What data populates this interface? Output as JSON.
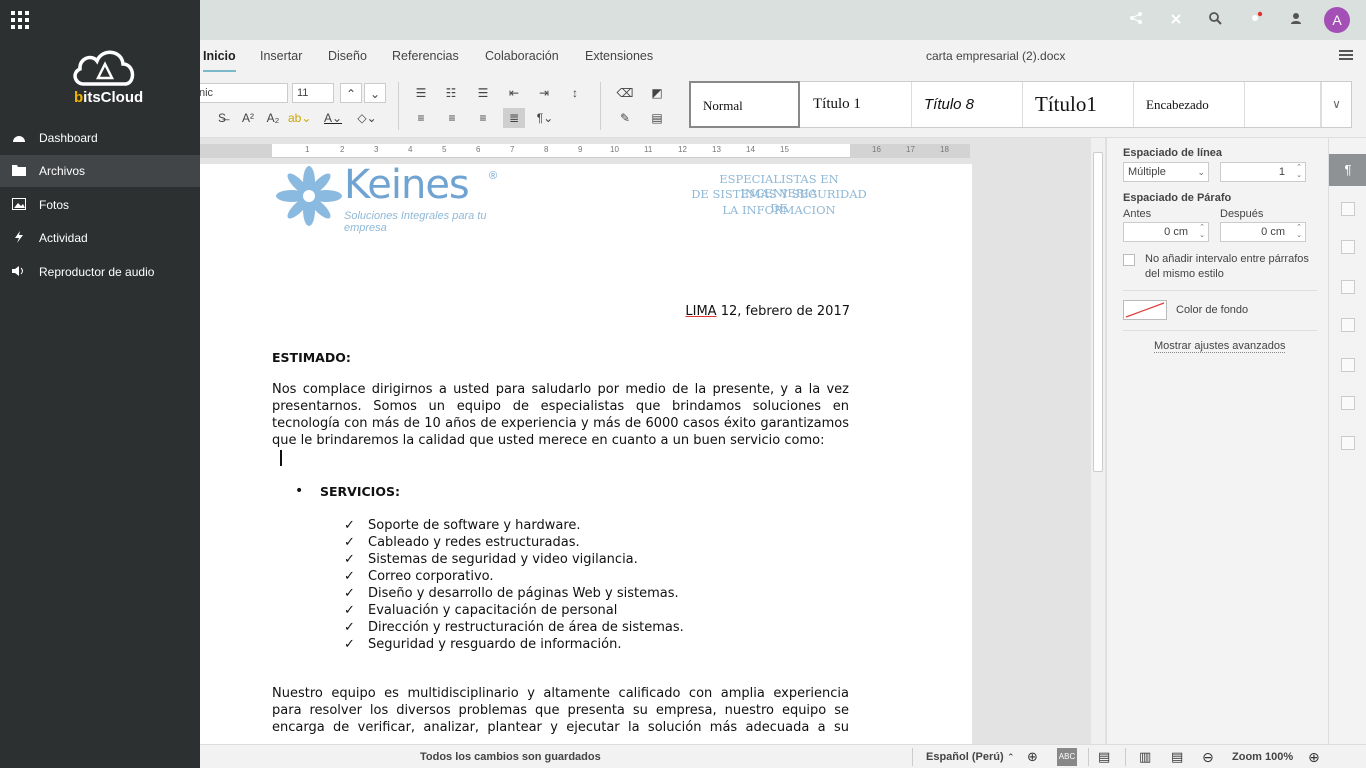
{
  "app": {
    "brand_prefix": "b",
    "brand_rest": "itsCloud",
    "user_initial": "A"
  },
  "drawer": {
    "items": [
      {
        "label": "Dashboard",
        "icon": "speedometer-icon"
      },
      {
        "label": "Archivos",
        "icon": "folder-icon",
        "active": true
      },
      {
        "label": "Fotos",
        "icon": "image-icon"
      },
      {
        "label": "Actividad",
        "icon": "lightning-icon"
      },
      {
        "label": "Reproductor de audio",
        "icon": "speaker-icon"
      }
    ]
  },
  "menu": {
    "tabs": [
      "Inicio",
      "Insertar",
      "Diseño",
      "Referencias",
      "Colaboración",
      "Extensiones"
    ],
    "active_tab": "Inicio",
    "doc_title": "carta empresarial (2).docx"
  },
  "toolbar": {
    "font_name": "nic",
    "font_size": "11",
    "styles": [
      "Normal",
      "Título 1",
      "Título 8",
      "Título1",
      "Encabezado",
      ""
    ]
  },
  "ruler": {
    "marks": [
      "1",
      "2",
      "3",
      "4",
      "5",
      "6",
      "7",
      "8",
      "9",
      "10",
      "11",
      "12",
      "13",
      "14",
      "15",
      "16",
      "17",
      "18"
    ]
  },
  "document": {
    "logo_word": "Keines",
    "logo_reg": "®",
    "logo_tagline": "Soluciones Integrales para tu empresa",
    "header_line1": "ESPECIALISTAS EN INGENIERIA",
    "header_line2": "DE SISTEMAS Y SEGURIDAD DE",
    "header_line3": "LA INFORMACION",
    "date_city": "LIMA",
    "date_rest": " 12, febrero de 2017",
    "salutation": "ESTIMADO:",
    "para1_lines": [
      "Nos complace dirigirnos a usted para saludarlo por medio de la presente, y a la vez",
      "presentarnos. Somos un equipo de especialistas que brindamos soluciones en",
      "tecnología con más de 10 años de experiencia y más de 6000 casos éxito garantizamos",
      "que le brindaremos la calidad que usted merece en cuanto a un buen servicio como:"
    ],
    "bullet_mark": "•",
    "services_heading": "SERVICIOS:",
    "check_mark": "✓",
    "services": [
      "Soporte de software y hardware.",
      "Cableado y redes estructuradas.",
      "Sistemas de seguridad y video vigilancia.",
      "Correo corporativo.",
      "Diseño y desarrollo de páginas Web y sistemas.",
      "Evaluación y capacitación de personal",
      "Dirección y restructuración de área de sistemas.",
      "Seguridad y resguardo de información."
    ],
    "para2_lines": [
      "Nuestro equipo es multidisciplinario y altamente calificado con amplia experiencia",
      "para resolver los diversos problemas que presenta su empresa, nuestro equipo se",
      "encarga de verificar, analizar, plantear y ejecutar la solución más adecuada a su"
    ]
  },
  "panel": {
    "line_spacing_title": "Espaciado de línea",
    "line_spacing_mode": "Múltiple",
    "line_spacing_value": "1",
    "para_spacing_title": "Espaciado de Párafo",
    "before_label": "Antes",
    "after_label": "Después",
    "before_value": "0 cm",
    "after_value": "0 cm",
    "no_interval_label_1": "No añadir intervalo entre párrafos",
    "no_interval_label_2": "del mismo estilo",
    "bg_color_label": "Color de fondo",
    "advanced_link": "Mostrar ajustes avanzados"
  },
  "status": {
    "saved": "Todos los cambios son guardados",
    "language": "Español (Perú)",
    "zoom": "Zoom 100%"
  },
  "colors": {
    "drawer_bg": "#2d3031",
    "avatar": "#a44fb5",
    "header_text": "#8fb8d6",
    "logo_blue": "#6fa3d1"
  }
}
